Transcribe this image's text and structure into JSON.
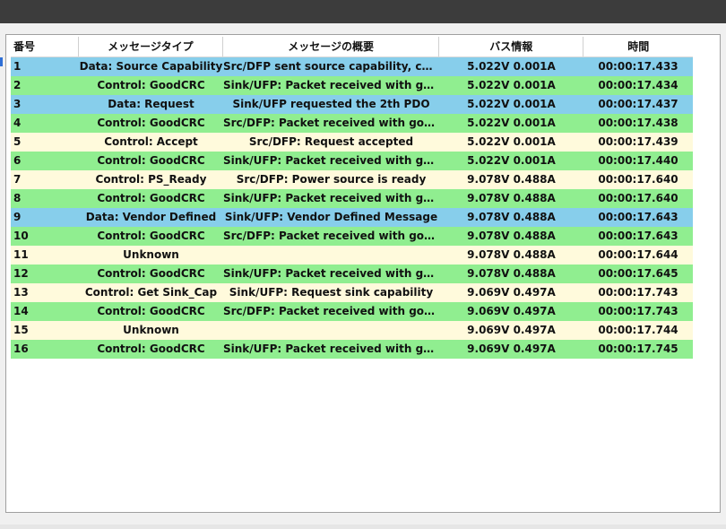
{
  "colors": {
    "top_bar": "#3c3c3c",
    "data_row": "#87ceeb",
    "goodcrc_row": "#90ee90",
    "control_row": "#fffadc",
    "panel_bg": "#ffffff"
  },
  "table": {
    "headers": [
      "番号",
      "メッセージタイプ",
      "メッセージの概要",
      "バス情報",
      "時間"
    ],
    "rows": [
      {
        "num": "1",
        "type": "Data: Source Capability",
        "summary": "Src/DFP sent source capability, con...",
        "bus": "5.022V 0.001A",
        "time": "00:00:17.433",
        "tone": "blue"
      },
      {
        "num": "2",
        "type": "Control: GoodCRC",
        "summary": "Sink/UFP: Packet received with goo...",
        "bus": "5.022V 0.001A",
        "time": "00:00:17.434",
        "tone": "green"
      },
      {
        "num": "3",
        "type": "Data: Request",
        "summary": "Sink/UFP requested the 2th PDO",
        "bus": "5.022V 0.001A",
        "time": "00:00:17.437",
        "tone": "blue"
      },
      {
        "num": "4",
        "type": "Control: GoodCRC",
        "summary": "Src/DFP: Packet received with good...",
        "bus": "5.022V 0.001A",
        "time": "00:00:17.438",
        "tone": "green"
      },
      {
        "num": "5",
        "type": "Control: Accept",
        "summary": "Src/DFP: Request accepted",
        "bus": "5.022V 0.001A",
        "time": "00:00:17.439",
        "tone": "yellow"
      },
      {
        "num": "6",
        "type": "Control: GoodCRC",
        "summary": "Sink/UFP: Packet received with goo...",
        "bus": "5.022V 0.001A",
        "time": "00:00:17.440",
        "tone": "green"
      },
      {
        "num": "7",
        "type": "Control: PS_Ready",
        "summary": "Src/DFP: Power source is ready",
        "bus": "9.078V 0.488A",
        "time": "00:00:17.640",
        "tone": "yellow"
      },
      {
        "num": "8",
        "type": "Control: GoodCRC",
        "summary": "Sink/UFP: Packet received with goo...",
        "bus": "9.078V 0.488A",
        "time": "00:00:17.640",
        "tone": "green"
      },
      {
        "num": "9",
        "type": "Data: Vendor Defined",
        "summary": "Sink/UFP: Vendor Defined Message",
        "bus": "9.078V 0.488A",
        "time": "00:00:17.643",
        "tone": "blue"
      },
      {
        "num": "10",
        "type": "Control: GoodCRC",
        "summary": "Src/DFP: Packet received with good...",
        "bus": "9.078V 0.488A",
        "time": "00:00:17.643",
        "tone": "green"
      },
      {
        "num": "11",
        "type": "Unknown",
        "summary": "",
        "bus": "9.078V 0.488A",
        "time": "00:00:17.644",
        "tone": "yellow"
      },
      {
        "num": "12",
        "type": "Control: GoodCRC",
        "summary": "Sink/UFP: Packet received with goo...",
        "bus": "9.078V 0.488A",
        "time": "00:00:17.645",
        "tone": "green"
      },
      {
        "num": "13",
        "type": "Control: Get Sink_Cap",
        "summary": "Sink/UFP: Request sink capability",
        "bus": "9.069V 0.497A",
        "time": "00:00:17.743",
        "tone": "yellow"
      },
      {
        "num": "14",
        "type": "Control: GoodCRC",
        "summary": "Src/DFP: Packet received with good...",
        "bus": "9.069V 0.497A",
        "time": "00:00:17.743",
        "tone": "green"
      },
      {
        "num": "15",
        "type": "Unknown",
        "summary": "",
        "bus": "9.069V 0.497A",
        "time": "00:00:17.744",
        "tone": "yellow"
      },
      {
        "num": "16",
        "type": "Control: GoodCRC",
        "summary": "Sink/UFP: Packet received with goo...",
        "bus": "9.069V 0.497A",
        "time": "00:00:17.745",
        "tone": "green"
      }
    ]
  }
}
